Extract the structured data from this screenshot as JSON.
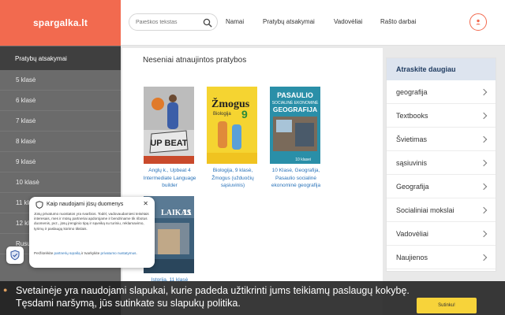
{
  "brand": "spargalka.lt",
  "search": {
    "placeholder": "Paieškos tekstas"
  },
  "nav": [
    "Namai",
    "Pratybų atsakymai",
    "Vadovėliai",
    "Rašto darbai"
  ],
  "sidebar": {
    "heading": "Pratybų atsakymai",
    "items": [
      "5 klasė",
      "6 klasė",
      "7 klasė",
      "8 klasė",
      "9 klasė",
      "10 klasė",
      "11 klasė",
      "12 klasė",
      "Rusų kalba"
    ]
  },
  "main": {
    "title": "Neseniai atnaujintos pratybos",
    "books": [
      {
        "title": "Anglų k., Upbeat 4 Intermediate Language builder",
        "cover_text": "UP BEAT",
        "cover_color": "#c94a2b"
      },
      {
        "title": "Biologija, 9 klasė, Žmogus (užduočių sąsiuvinis)",
        "cover_text": "Žmogus",
        "cover_sub": "Biologija 9",
        "cover_color": "#f5d431"
      },
      {
        "title": "10 Klasė, Geografija, Pasaulio socialinė ekonominė geografija",
        "cover_text": "PASAULIO SOCIALINĖ EKONOMINĖ GEOGRAFIJA",
        "cover_color": "#2a8fa8"
      },
      {
        "title": "Istorija, 11 klasė",
        "cover_text": "LAIKAS 11",
        "cover_color": "#3c5f7a"
      }
    ]
  },
  "right": {
    "heading": "Atraskite daugiau",
    "items": [
      "geografija",
      "Textbooks",
      "Švietimas",
      "sąsiuvinis",
      "Geografija",
      "Socialiniai mokslai",
      "Vadovėliai",
      "Naujienos"
    ]
  },
  "privacy": {
    "title": "Kaip naudojami jūsų duomenys",
    "body": "Jūsų privatumo nuostatos yra svarbios. Todėl, vadovaudamiesi teisėtais interesais, mes ir mūsų partneriai apdorojame ir bendriname tik ribotus duomenis, pvz., jūsų įrenginio tipą ir sąveiką su turiniu, reklamavimo, tyrimų ir paslaugų kūrimo tikslais.",
    "foot_prefix": "Peržiūrėkite",
    "foot_link1": "partnerių sąrašą",
    "foot_mid": "ir tvarkykite",
    "foot_link2": "privatumo nustatymus",
    "foot_end": "."
  },
  "cookie": {
    "text": "Svetainėje yra naudojami slapukai, kurie padeda užtikrinti jums teikiamų paslaugų kokybę. Tęsdami naršymą, jūs sutinkate su slapukų politika.",
    "accept": "Sutinku!"
  },
  "colors": {
    "brand": "#f26a4f",
    "sidebar": "#6b6b6b",
    "accept": "#f7d33a",
    "link": "#2a73b9"
  }
}
